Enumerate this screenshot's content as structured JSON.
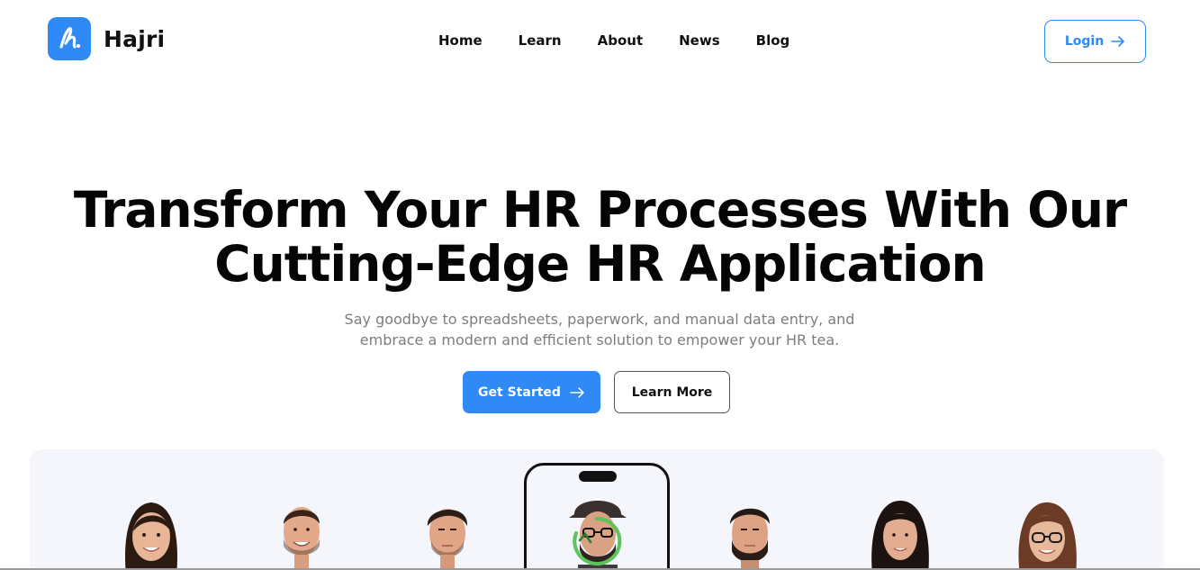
{
  "brand": {
    "name": "Hajri",
    "logo_icon": "hajri-logo-icon",
    "accent": "#2f8af5"
  },
  "nav": {
    "items": [
      {
        "label": "Home"
      },
      {
        "label": "Learn"
      },
      {
        "label": "About"
      },
      {
        "label": "News"
      },
      {
        "label": "Blog"
      }
    ],
    "login_label": "Login"
  },
  "hero": {
    "title_line1": "Transform Your HR Processes With Our",
    "title_line2": "Cutting-Edge HR Application",
    "subtitle_line1": "Say goodbye to spreadsheets, paperwork, and manual data entry, and",
    "subtitle_line2": "embrace a modern and efficient solution to empower your HR tea.",
    "primary_cta": "Get Started",
    "secondary_cta": "Learn More"
  },
  "showcase": {
    "faces": [
      "woman-smiling",
      "man-smiling",
      "man-serious",
      "man-hat-glasses",
      "man-beard",
      "woman-dark-hair",
      "woman-glasses"
    ],
    "scan_status_color": "#5cc45a"
  }
}
